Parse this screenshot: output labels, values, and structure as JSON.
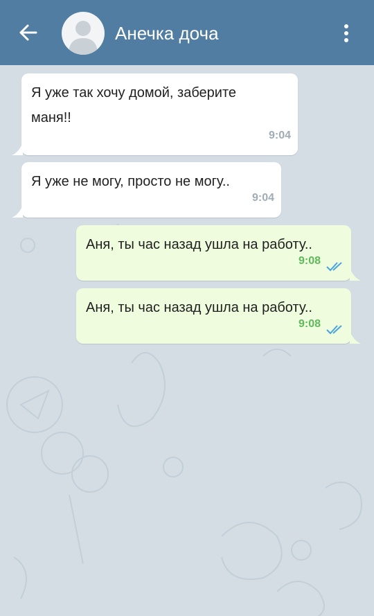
{
  "header": {
    "title": "Анечка доча"
  },
  "messages": [
    {
      "direction": "in",
      "text_line1": "Я уже так хочу домой, заберите",
      "text_line2": "маня!!",
      "time": "9:04"
    },
    {
      "direction": "in",
      "text": "Я уже не могу,  просто не могу..",
      "time": "9:04"
    },
    {
      "direction": "out",
      "text": "Аня, ты час назад ушла на работу..",
      "time": "9:08",
      "status": "read-double-check"
    },
    {
      "direction": "out",
      "text": "Аня, ты час назад ушла на работу..",
      "time": "9:08",
      "status": "read-double-check"
    }
  ],
  "colors": {
    "header": "#517da2",
    "incoming": "#ffffff",
    "outgoing": "#effdde",
    "outgoing_time": "#5fb95a",
    "check": "#4aa3df"
  }
}
